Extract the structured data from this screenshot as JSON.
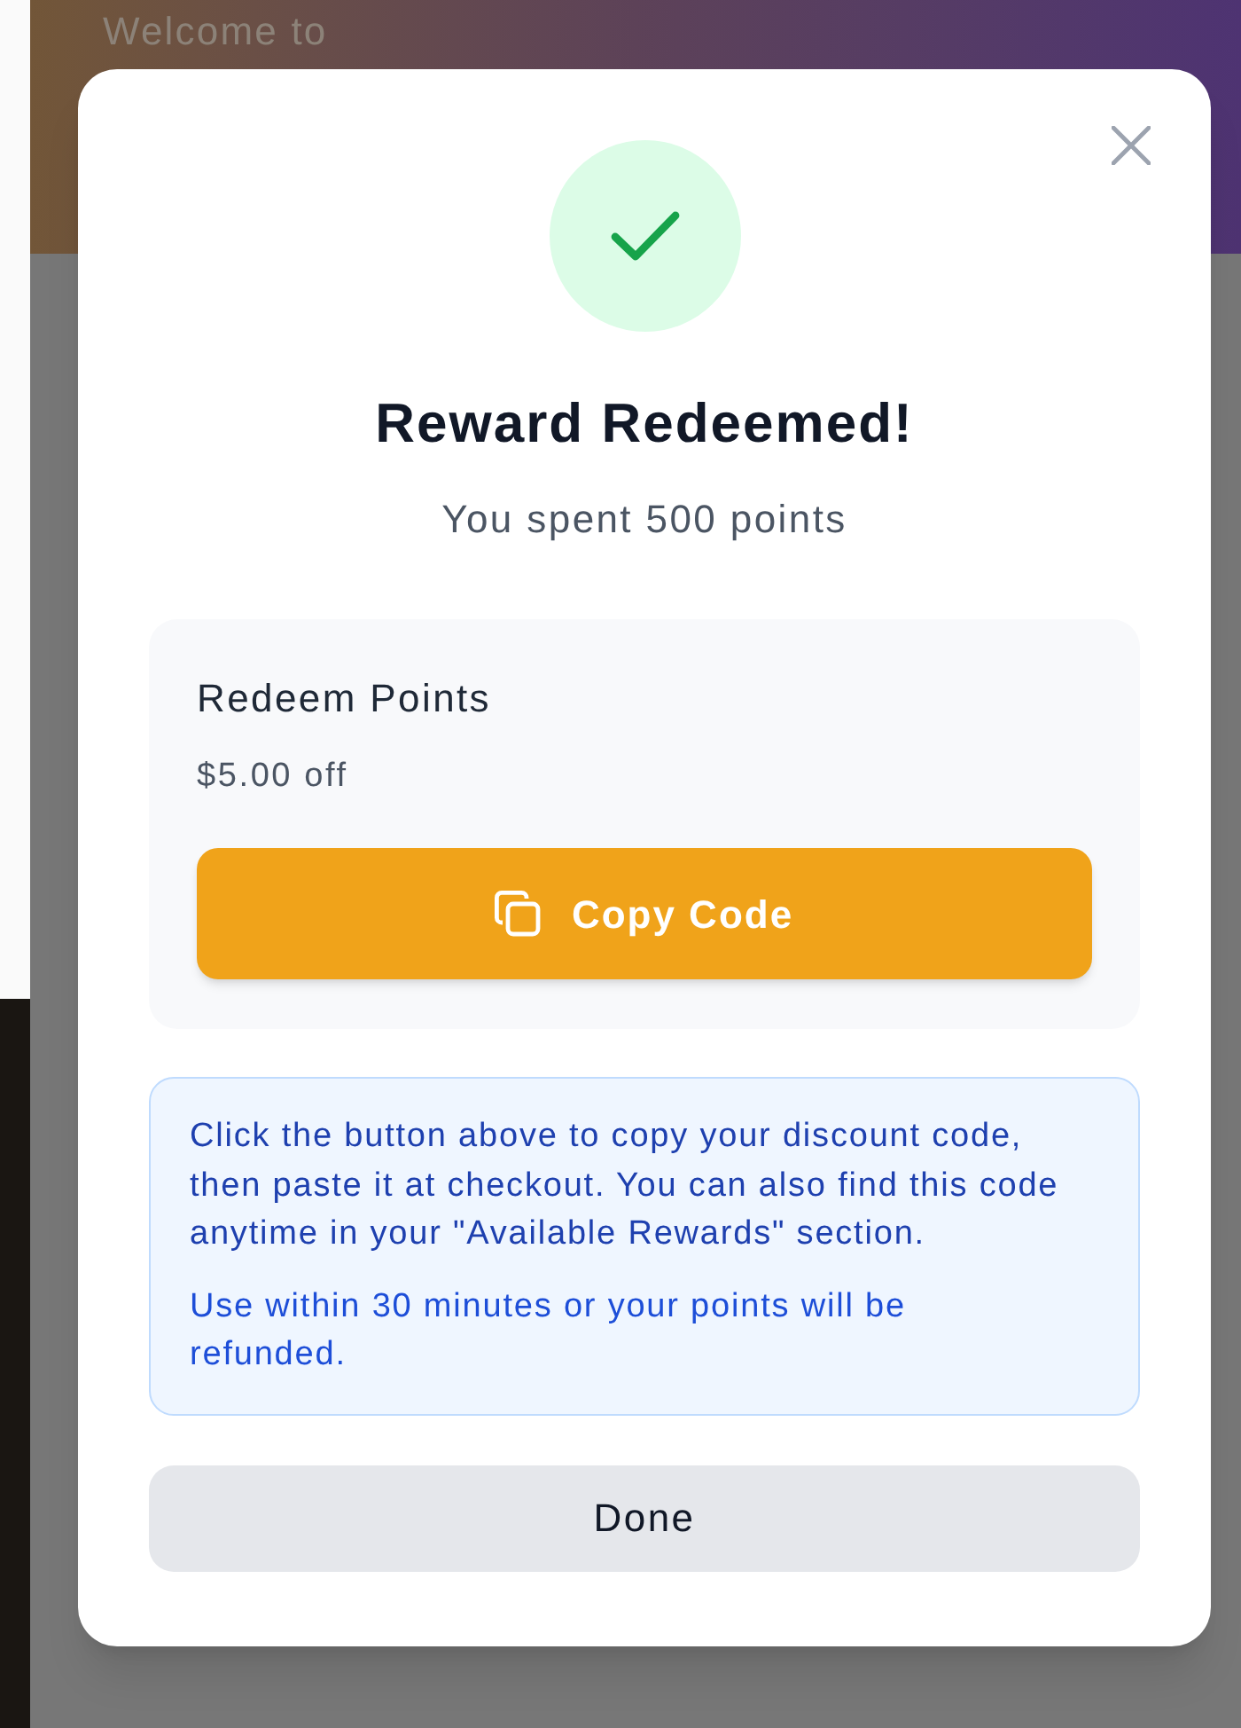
{
  "background": {
    "greeting": "Welcome to"
  },
  "dialog": {
    "badge": {
      "kind": "success"
    },
    "title": "Reward Redeemed!",
    "subtitle": "You spent 500 points",
    "reward": {
      "name": "Redeem Points",
      "value": "$5.00 off",
      "button": {
        "label": "Copy Code"
      }
    },
    "info": {
      "paragraphs": [
        {
          "kind": "instruction",
          "text": "Click the button above to copy your discount code, then paste it at checkout. You can also find this code anytime in your \"Available Rewards\" section."
        },
        {
          "kind": "note",
          "text": "Use within 30 minutes or your points will be refunded."
        }
      ]
    },
    "done_button": {
      "label": "Done"
    }
  }
}
